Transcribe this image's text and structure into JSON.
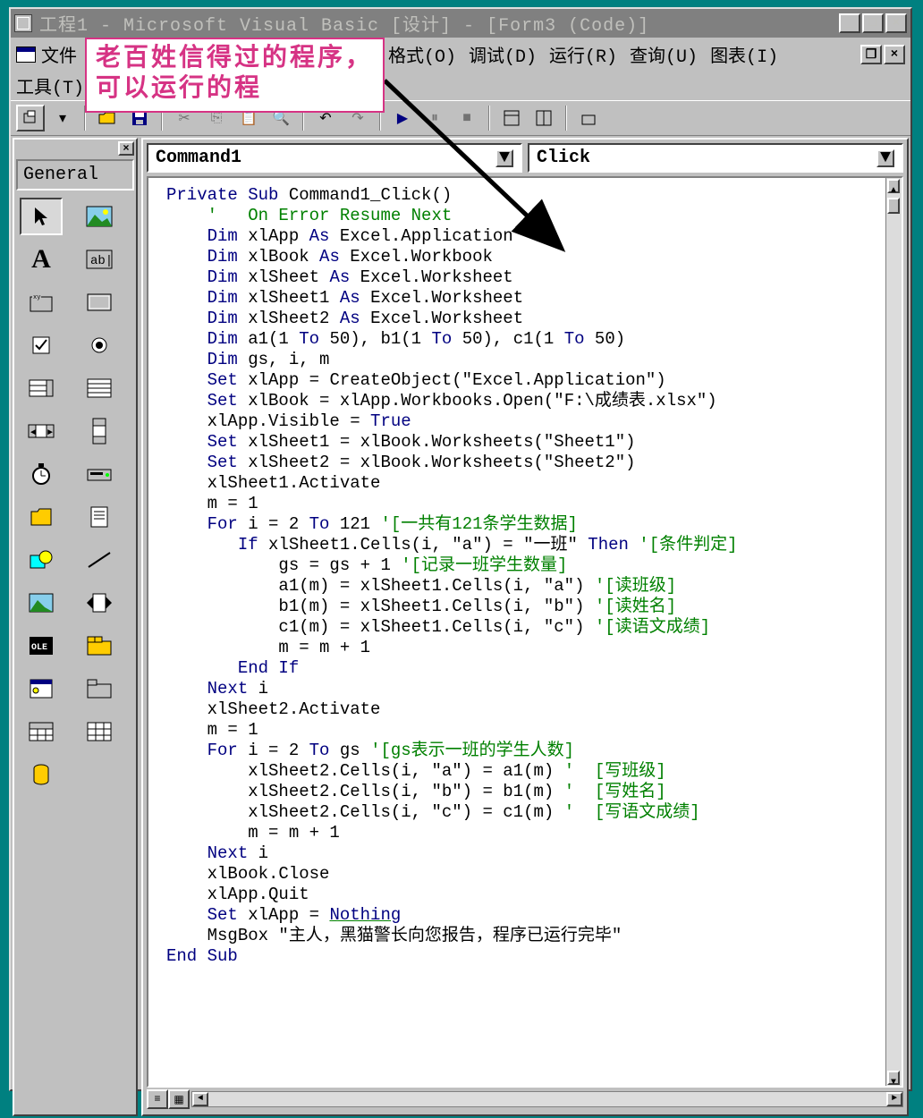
{
  "titlebar": {
    "text": "工程1 - Microsoft Visual Basic [设计] - [Form3 (Code)]"
  },
  "menus": {
    "file": "文件",
    "format": "格式(O)",
    "debug": "调试(D)",
    "run": "运行(R)",
    "query": "查询(U)",
    "chart": "图表(I)",
    "tools": "工具(T)"
  },
  "callout": "老百姓信得过的程序，可以运行的程",
  "dropdown": {
    "object": "Command1",
    "event": "Click"
  },
  "panel": {
    "title": "General"
  },
  "code": {
    "l1a": "Private Sub",
    "l1b": " Command1_Click()",
    "l2": "'   On Error Resume Next",
    "l3a": "Dim",
    "l3b": " xlApp ",
    "l3c": "As",
    "l3d": " Excel.Application",
    "l4a": "Dim",
    "l4b": " xlBook ",
    "l4c": "As",
    "l4d": " Excel.Workbook",
    "l5a": "Dim",
    "l5b": " xlSheet ",
    "l5c": "As",
    "l5d": " Excel.Worksheet",
    "l6a": "Dim",
    "l6b": " xlSheet1 ",
    "l6c": "As",
    "l6d": " Excel.Worksheet",
    "l7a": "Dim",
    "l7b": " xlSheet2 ",
    "l7c": "As",
    "l7d": " Excel.Worksheet",
    "l8a": "Dim",
    "l8b": " a1(1 ",
    "l8c": "To",
    "l8d": " 50), b1(1 ",
    "l8e": "To",
    "l8f": " 50), c1(1 ",
    "l8g": "To",
    "l8h": " 50)",
    "l9a": "Dim",
    "l9b": " gs, i, m",
    "l10a": "Set",
    "l10b": " xlApp = CreateObject(\"Excel.Application\")",
    "l11a": "Set",
    "l11b": " xlBook = xlApp.Workbooks.Open(\"F:\\成绩表.xlsx\")",
    "l12": "xlApp.Visible = ",
    "l12b": "True",
    "l13a": "Set",
    "l13b": " xlSheet1 = xlBook.Worksheets(\"Sheet1\")",
    "l14a": "Set",
    "l14b": " xlSheet2 = xlBook.Worksheets(\"Sheet2\")",
    "l15": "xlSheet1.Activate",
    "l16": "m = 1",
    "l17a": "For",
    "l17b": " i = 2 ",
    "l17c": "To",
    "l17d": " 121 ",
    "l17e": "'[一共有121条学生数据]",
    "l18a": "If",
    "l18b": " xlSheet1.Cells(i, \"a\") = \"一班\" ",
    "l18c": "Then",
    "l18d": " '[条件判定]",
    "l19a": "gs = gs + 1 ",
    "l19b": "'[记录一班学生数量]",
    "l20a": "a1(m) = xlSheet1.Cells(i, \"a\") ",
    "l20b": "'[读班级]",
    "l21a": "b1(m) = xlSheet1.Cells(i, \"b\") ",
    "l21b": "'[读姓名]",
    "l22a": "c1(m) = xlSheet1.Cells(i, \"c\") ",
    "l22b": "'[读语文成绩]",
    "l23": "m = m + 1",
    "l24": "End If",
    "l25a": "Next",
    "l25b": " i",
    "l26": "xlSheet2.Activate",
    "l27": "m = 1",
    "l28a": "For",
    "l28b": " i = 2 ",
    "l28c": "To",
    "l28d": " gs ",
    "l28e": "'[gs表示一班的学生人数]",
    "l29a": "xlSheet2.Cells(i, \"a\") = a1(m) ",
    "l29b": "'  [写班级]",
    "l30a": "xlSheet2.Cells(i, \"b\") = b1(m) ",
    "l30b": "'  [写姓名]",
    "l31a": "xlSheet2.Cells(i, \"c\") = c1(m) ",
    "l31b": "'  [写语文成绩]",
    "l32": "m = m + 1",
    "l33a": "Next",
    "l33b": " i",
    "l34": "xlBook.Close",
    "l35": "xlApp.Quit",
    "l36a": "Set",
    "l36b": " xlApp = ",
    "l36c": "Nothing",
    "l37": "MsgBox \"主人，黑猫警长向您报告，程序已运行完毕\"",
    "l38": "End Sub"
  }
}
